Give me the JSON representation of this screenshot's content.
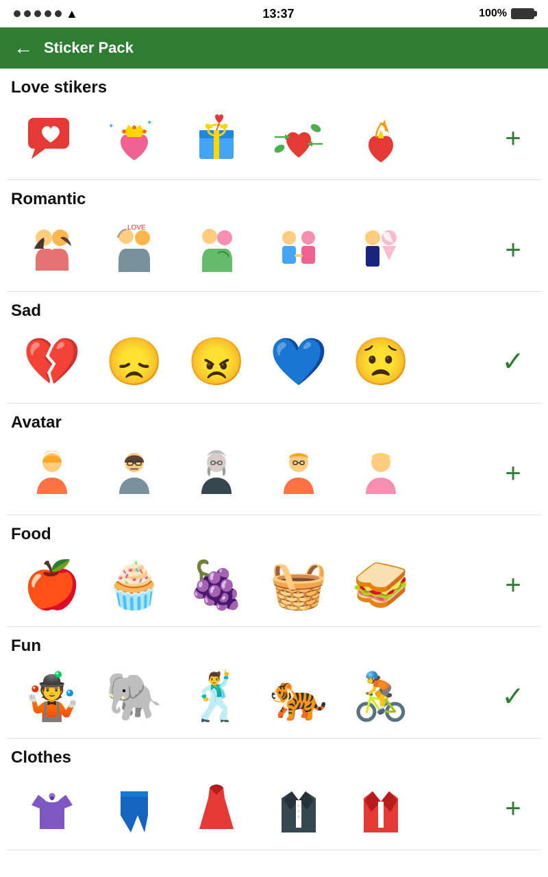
{
  "statusBar": {
    "time": "13:37",
    "battery": "100%",
    "signal_dots": 5
  },
  "header": {
    "back_label": "←",
    "title": "Sticker Pack"
  },
  "sections": [
    {
      "id": "love",
      "title": "Love stikers",
      "action": "plus",
      "stickers": [
        "love_chat",
        "love_heart_crown",
        "love_gift",
        "love_arrows",
        "love_flame"
      ]
    },
    {
      "id": "romantic",
      "title": "Romantic",
      "action": "plus",
      "stickers": [
        "romantic_couple1",
        "romantic_couple2",
        "romantic_couple3",
        "romantic_couple4",
        "romantic_wedding"
      ]
    },
    {
      "id": "sad",
      "title": "Sad",
      "action": "check",
      "stickers": [
        "sad_heart",
        "sad_face",
        "angry_face",
        "sad_blue_heart",
        "sad_face2"
      ]
    },
    {
      "id": "avatar",
      "title": "Avatar",
      "action": "plus",
      "stickers": [
        "avatar_girl1",
        "avatar_girl2",
        "avatar_man1",
        "avatar_man2",
        "avatar_girl3"
      ]
    },
    {
      "id": "food",
      "title": "Food",
      "action": "plus",
      "stickers": [
        "food_apple",
        "food_cupcake",
        "food_grapes",
        "food_basket",
        "food_sandwich"
      ]
    },
    {
      "id": "fun",
      "title": "Fun",
      "action": "check",
      "stickers": [
        "fun_clown",
        "fun_elephant",
        "fun_dancer",
        "fun_tiger",
        "fun_cyclist"
      ]
    },
    {
      "id": "clothes",
      "title": "Clothes",
      "action": "plus",
      "stickers": [
        "clothes_shirt",
        "clothes_jeans",
        "clothes_dress",
        "clothes_suit",
        "clothes_jacket"
      ]
    }
  ]
}
